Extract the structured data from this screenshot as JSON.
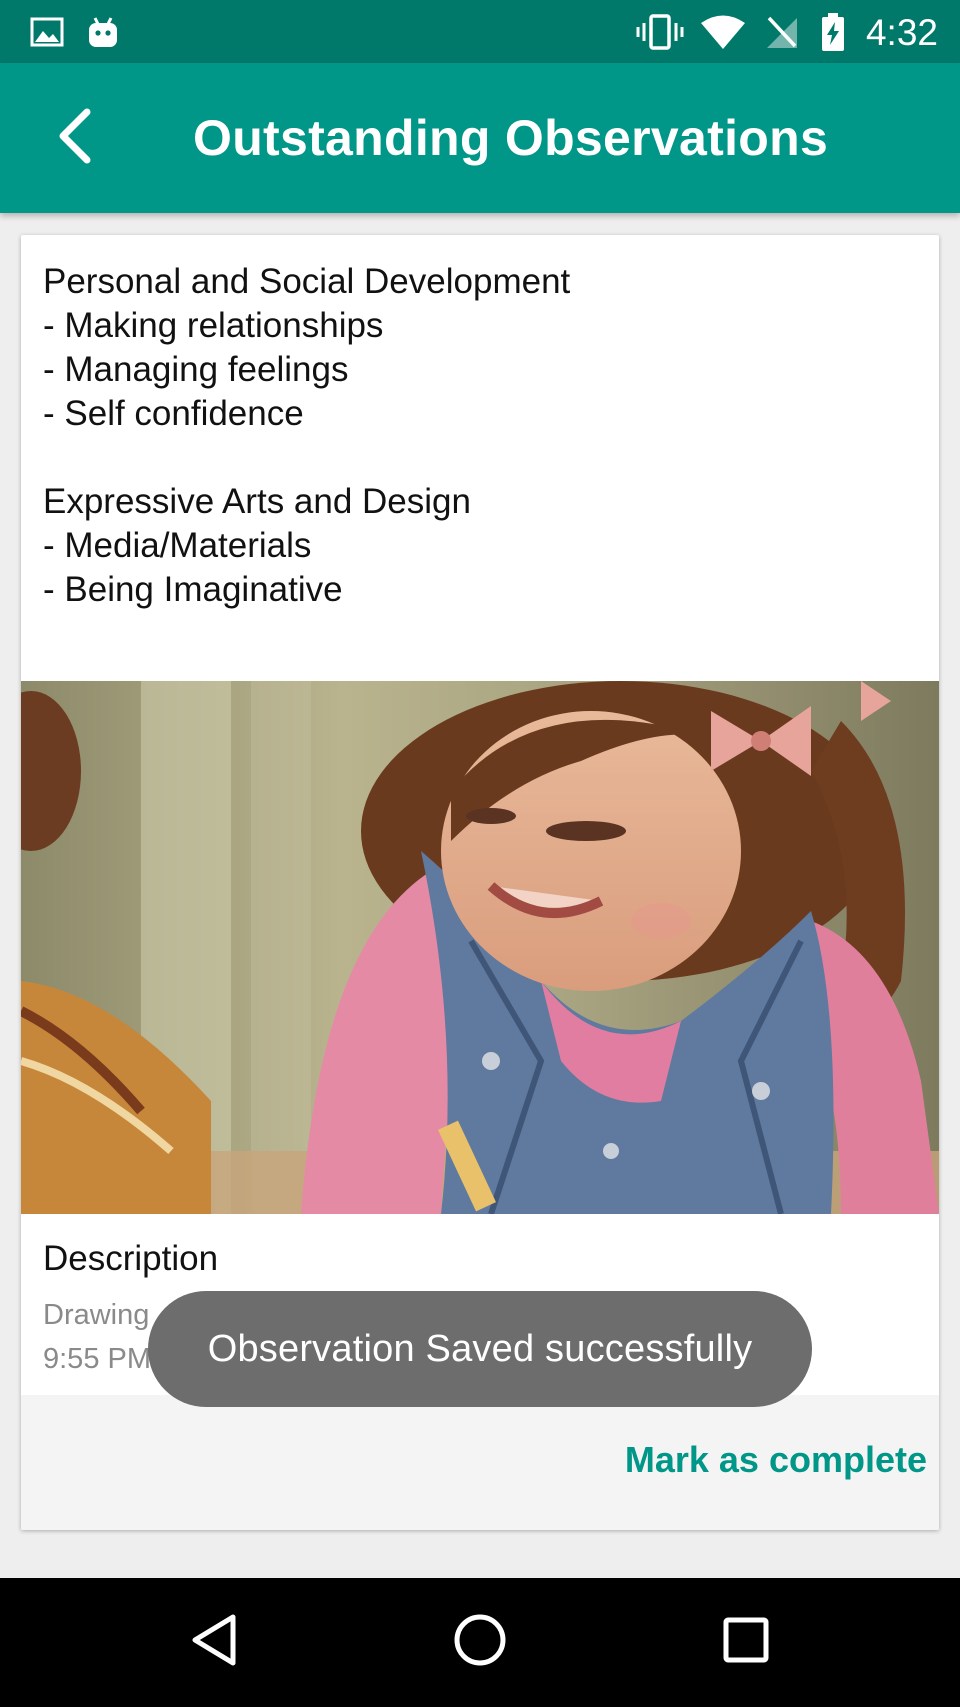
{
  "status_bar": {
    "time": "4:32",
    "left_icons": [
      "image-icon",
      "android-icon"
    ],
    "right_icons": [
      "vibrate-icon",
      "wifi-icon",
      "no-sim-icon",
      "battery-charging-icon"
    ]
  },
  "app_bar": {
    "title": "Outstanding Observations",
    "back_icon": "back-arrow-icon"
  },
  "observation": {
    "areas": [
      "Personal and Social Development",
      "- Making relationships",
      "- Managing feelings",
      "- Self confidence",
      "",
      "Expressive Arts and Design",
      "- Media/Materials",
      "- Being Imaginative"
    ],
    "photo": "Smiling girl with pigtails in a denim vest, drawing at a table",
    "description_title": "Description",
    "description_text": "Drawing",
    "description_time": "9:55 PM",
    "action_label": "Mark as complete"
  },
  "toast": {
    "message": "Observation Saved successfully"
  },
  "nav_bar": {
    "buttons": [
      "back-triangle-icon",
      "home-circle-icon",
      "recents-square-icon"
    ]
  },
  "colors": {
    "status_bar": "#00796b",
    "app_bar": "#009688",
    "accent": "#009688",
    "toast": "#6d6d6d"
  }
}
